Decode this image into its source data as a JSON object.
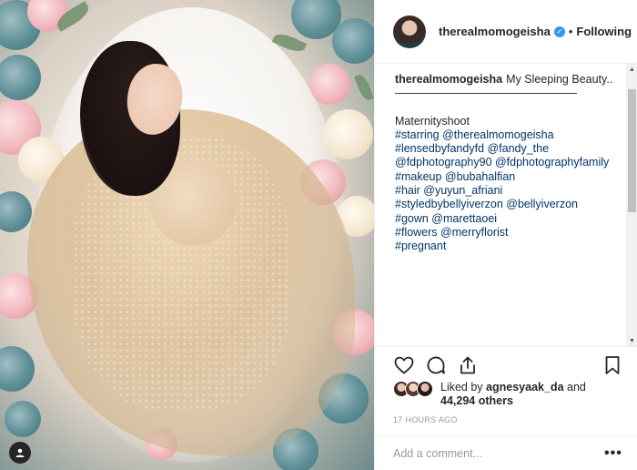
{
  "post": {
    "username": "therealmomogeisha",
    "follow_status": "Following",
    "separator": "•"
  },
  "caption": {
    "username": "therealmomogeisha",
    "lines": [
      "My Sleeping Beauty..",
      "————————————————",
      "Maternityshoot",
      "#starring @therealmomogeisha",
      "#lensedbyfandyfd @fandy_the",
      "@fdphotography90 @fdphotographyfamily",
      "#makeup @bubahalfian",
      "#hair @yuyun_afriani",
      "#styledbybellyiverzon @bellyiverzon",
      "#gown @marettaoei",
      "#flowers @merryflorist",
      "#pregnant"
    ]
  },
  "likes": {
    "prefix": "Liked by",
    "user": "agnesyaak_da",
    "middle": "and",
    "count": "44,294 others"
  },
  "timestamp": "17 HOURS AGO",
  "comment": {
    "placeholder": "Add a comment..."
  },
  "icons": {
    "like": "heart-icon",
    "comment": "comment-bubble-icon",
    "share": "share-icon",
    "save": "bookmark-icon",
    "more": "more-options-icon",
    "verified": "verified-badge-icon",
    "tagged_user": "user-tag-icon"
  },
  "colors": {
    "link": "#003569",
    "verified": "#3897f0",
    "muted": "#999999",
    "text": "#262626"
  }
}
